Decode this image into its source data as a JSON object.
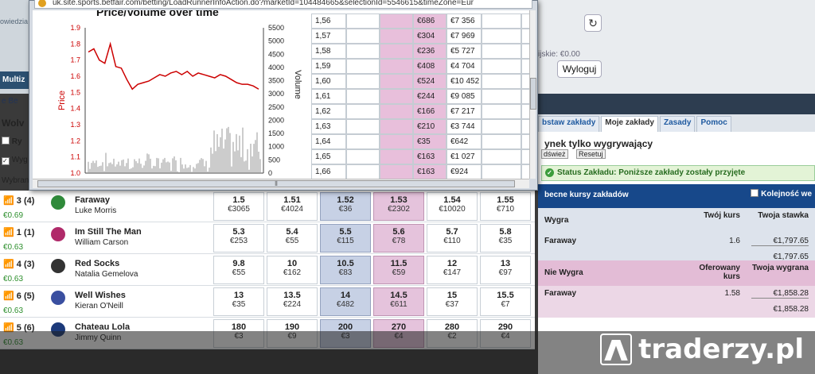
{
  "popup": {
    "url": "uk.site.sports.betfair.com/betting/LoadRunnerInfoAction.do?marketId=104484665&selectionId=5546615&timeZone=Eur",
    "chart_title": "Price/Volume over time",
    "ladder": [
      {
        "price": "1,56",
        "lay": "€686",
        "vol": "€7 356"
      },
      {
        "price": "1,57",
        "lay": "€304",
        "vol": "€7 969"
      },
      {
        "price": "1,58",
        "lay": "€236",
        "vol": "€5 727"
      },
      {
        "price": "1,59",
        "lay": "€408",
        "vol": "€4 704"
      },
      {
        "price": "1,60",
        "lay": "€524",
        "vol": "€10 452"
      },
      {
        "price": "1,61",
        "lay": "€244",
        "vol": "€9 085"
      },
      {
        "price": "1,62",
        "lay": "€166",
        "vol": "€7 217"
      },
      {
        "price": "1,63",
        "lay": "€210",
        "vol": "€3 744"
      },
      {
        "price": "1,64",
        "lay": "€35",
        "vol": "€642"
      },
      {
        "price": "1,65",
        "lay": "€163",
        "vol": "€1 027"
      },
      {
        "price": "1,66",
        "lay": "€163",
        "vol": "€924"
      }
    ]
  },
  "chart_data": {
    "type": "line",
    "title": "Price/Volume over time",
    "ylabel": "Price",
    "y2label": "Volume",
    "ylim": [
      1.0,
      1.9
    ],
    "y2lim": [
      0,
      5500
    ],
    "yticks": [
      "1.9",
      "1.8",
      "1.7",
      "1.6",
      "1.5",
      "1.4",
      "1.3",
      "1.2",
      "1.1",
      "1.0"
    ],
    "y2ticks": [
      "5500",
      "5000",
      "4500",
      "4000",
      "3500",
      "3000",
      "2500",
      "2000",
      "1500",
      "1000",
      "500",
      "0"
    ],
    "series": [
      {
        "values": [
          1.75,
          1.77,
          1.7,
          1.68,
          1.8,
          1.66,
          1.65,
          1.58,
          1.52,
          1.55,
          1.56,
          1.57,
          1.59,
          1.61,
          1.6,
          1.62,
          1.63,
          1.61,
          1.63,
          1.6,
          1.62,
          1.61,
          1.6,
          1.59,
          1.61,
          1.6,
          1.58,
          1.56,
          1.55,
          1.55,
          1.54,
          1.52
        ]
      }
    ]
  },
  "page": {
    "left_strip": "owiedzia",
    "balance": "ijskie: €0.00",
    "logout": "Wyloguj",
    "navbar_label": "Multiz",
    "crumbs": "e  Be",
    "market_title": "Wolv",
    "ctrl1": "Ry",
    "ctrl2": "Wyg",
    "ctrl3": "Wybran"
  },
  "right_panel": {
    "tabs": [
      "bstaw zakłady",
      "Moje zakłady",
      "Zasady",
      "Pomoc"
    ],
    "only_win": "ynek tylko wygrywający",
    "refresh_btn": "dśwież",
    "reset_btn": "Resetuj",
    "status_text": "Status Zakładu: Poniższe zakłady zostały przyjęte",
    "current_odds": "becne kursy zakładów",
    "sequence_label": "Kolejność we",
    "back_section": {
      "label": "Wygra",
      "col1": "Twój kurs",
      "col2": "Twoja stawka",
      "runner": "Faraway",
      "odds": "1.6",
      "stake": "€1,797.65",
      "total": "€1,797.65"
    },
    "lay_section": {
      "label": "Nie Wygra",
      "col1": "Oferowany kurs",
      "col2": "Twoja wygrana",
      "runner": "Faraway",
      "odds": "1.58",
      "stake": "€1,858.28",
      "total": "€1,858.28"
    }
  },
  "runners": [
    {
      "num": "3",
      "draw": "(4)",
      "name": "Faraway",
      "jockey": "Luke Morris",
      "val": "€0.69",
      "silk": "#2f8a3a",
      "cells": [
        {
          "o": "1.5",
          "v": "€3065"
        },
        {
          "o": "1.51",
          "v": "€4024"
        },
        {
          "o": "1.52",
          "v": "€36"
        },
        {
          "o": "1.53",
          "v": "€2302"
        },
        {
          "o": "1.54",
          "v": "€10020"
        },
        {
          "o": "1.55",
          "v": "€710"
        }
      ]
    },
    {
      "num": "1",
      "draw": "(1)",
      "name": "Im Still The Man",
      "jockey": "William Carson",
      "val": "€0.63",
      "silk": "#b02a6a",
      "cells": [
        {
          "o": "5.3",
          "v": "€253"
        },
        {
          "o": "5.4",
          "v": "€55"
        },
        {
          "o": "5.5",
          "v": "€115"
        },
        {
          "o": "5.6",
          "v": "€78"
        },
        {
          "o": "5.7",
          "v": "€110"
        },
        {
          "o": "5.8",
          "v": "€35"
        }
      ]
    },
    {
      "num": "4",
      "draw": "(3)",
      "name": "Red Socks",
      "jockey": "Natalia Gemelova",
      "val": "€0.63",
      "silk": "#333333",
      "cells": [
        {
          "o": "9.8",
          "v": "€55"
        },
        {
          "o": "10",
          "v": "€162"
        },
        {
          "o": "10.5",
          "v": "€83"
        },
        {
          "o": "11.5",
          "v": "€59"
        },
        {
          "o": "12",
          "v": "€147"
        },
        {
          "o": "13",
          "v": "€97"
        }
      ]
    },
    {
      "num": "6",
      "draw": "(5)",
      "name": "Well Wishes",
      "jockey": "Kieran O'Neill",
      "val": "€0.63",
      "silk": "#3a4fa0",
      "cells": [
        {
          "o": "13",
          "v": "€35"
        },
        {
          "o": "13.5",
          "v": "€224"
        },
        {
          "o": "14",
          "v": "€482"
        },
        {
          "o": "14.5",
          "v": "€611"
        },
        {
          "o": "15",
          "v": "€37"
        },
        {
          "o": "15.5",
          "v": "€7"
        }
      ]
    },
    {
      "num": "5",
      "draw": "(6)",
      "name": "Chateau Lola",
      "jockey": "Jimmy Quinn",
      "val": "€0.63",
      "silk": "#1c3a7a",
      "cells": [
        {
          "o": "180",
          "v": "€3"
        },
        {
          "o": "190",
          "v": "€9"
        },
        {
          "o": "200",
          "v": "€3"
        },
        {
          "o": "270",
          "v": "€4"
        },
        {
          "o": "280",
          "v": "€2"
        },
        {
          "o": "290",
          "v": "€4"
        }
      ]
    }
  ],
  "watermark": {
    "text": "traderzy.pl"
  }
}
